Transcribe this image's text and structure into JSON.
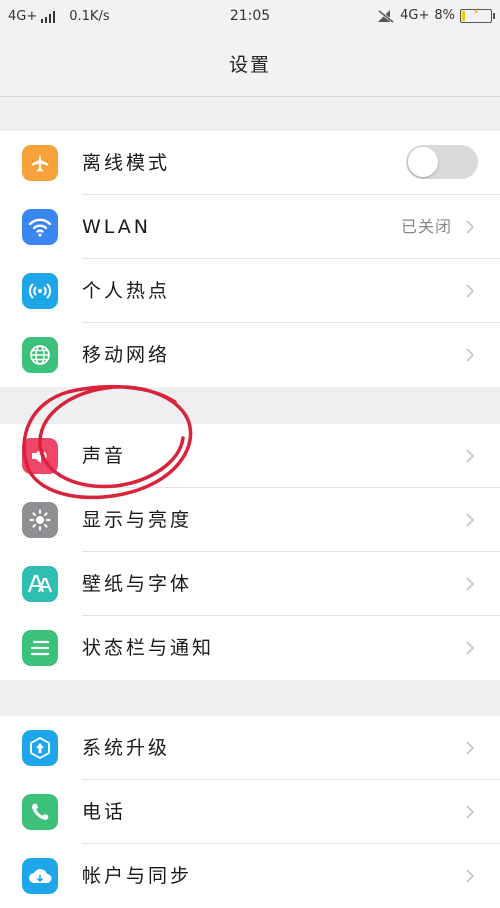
{
  "status_bar": {
    "network": "4G+",
    "speed": "0.1K/s",
    "time": "21:05",
    "network_right": "4G+",
    "battery": "8%"
  },
  "header": {
    "title": "设置"
  },
  "groups": [
    {
      "items": [
        {
          "label": "离线模式",
          "icon": "airplane-icon",
          "color": "#f6a23a",
          "toggle": "off"
        },
        {
          "label": "WLAN",
          "icon": "wifi-icon",
          "color": "#3a86f0",
          "value": "已关闭"
        },
        {
          "label": "个人热点",
          "icon": "hotspot-icon",
          "color": "#1ea6e8"
        },
        {
          "label": "移动网络",
          "icon": "globe-icon",
          "color": "#3cc17a"
        }
      ]
    },
    {
      "items": [
        {
          "label": "声音",
          "icon": "speaker-icon",
          "color": "#f0466a"
        },
        {
          "label": "显示与亮度",
          "icon": "brightness-icon",
          "color": "#8e8e93"
        },
        {
          "label": "壁纸与字体",
          "icon": "font-icon",
          "color": "#2fbfb2"
        },
        {
          "label": "状态栏与通知",
          "icon": "notification-icon",
          "color": "#3cc17a"
        }
      ]
    },
    {
      "items": [
        {
          "label": "系统升级",
          "icon": "upgrade-icon",
          "color": "#1ea6e8"
        },
        {
          "label": "电话",
          "icon": "phone-icon",
          "color": "#3cc17a"
        },
        {
          "label": "帐户与同步",
          "icon": "cloud-icon",
          "color": "#1ea6e8"
        }
      ]
    }
  ],
  "annotation_color": "#d9233a"
}
